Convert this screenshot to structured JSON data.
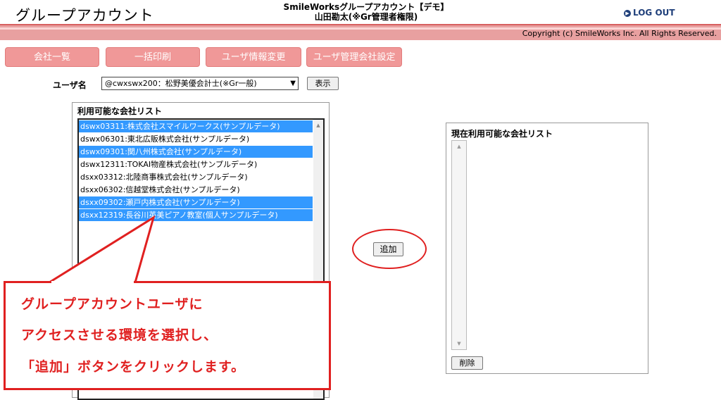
{
  "header": {
    "app_title": "グループアカウント",
    "center_line1": "SmileWorksグループアカウント【デモ】",
    "center_line2": "山田勘太(※Gr管理者権限)",
    "logout_label": "LOG OUT",
    "copyright": "Copyright (c) SmileWorks Inc. All Rights Reserved."
  },
  "nav": {
    "company_list": "会社一覧",
    "batch_print": "一括印刷",
    "user_info_change": "ユーザ情報変更",
    "user_admin_settings": "ユーザ管理会社設定"
  },
  "user_select": {
    "label": "ユーザ名",
    "value": "@cwxswx200：松野美優会計士(※Gr一般)",
    "show_button": "表示"
  },
  "available_list": {
    "title": "利用可能な会社リスト",
    "items": [
      {
        "text": "dswx03311:株式会社スマイルワークス(サンプルデータ)",
        "selected": true
      },
      {
        "text": "dswx06301:東北広販株式会社(サンプルデータ)",
        "selected": false
      },
      {
        "text": "dswx09301:関八州株式会社(サンプルデータ)",
        "selected": true
      },
      {
        "text": "dswx12311:TOKAI物産株式会社(サンプルデータ)",
        "selected": false
      },
      {
        "text": "dsxx03312:北陸商事株式会社(サンプルデータ)",
        "selected": false
      },
      {
        "text": "dsxx06302:信越堂株式会社(サンプルデータ)",
        "selected": false
      },
      {
        "text": "dsxx09302:瀬戸内株式会社(サンプルデータ)",
        "selected": true
      },
      {
        "text": "dsxx12319:長谷川英美ピアノ教室(個人サンプルデータ)",
        "selected": true
      }
    ]
  },
  "add_button": "追加",
  "current_list": {
    "title": "現在利用可能な会社リスト",
    "delete_button": "削除"
  },
  "callout": {
    "line1": "グループアカウントユーザに",
    "line2": "アクセスさせる環境を選択し、",
    "line3": "「追加」ボタンをクリックします。"
  },
  "colors": {
    "accent_red": "#e02020",
    "nav_pink": "#f09898",
    "selection_blue": "#3399ff"
  }
}
